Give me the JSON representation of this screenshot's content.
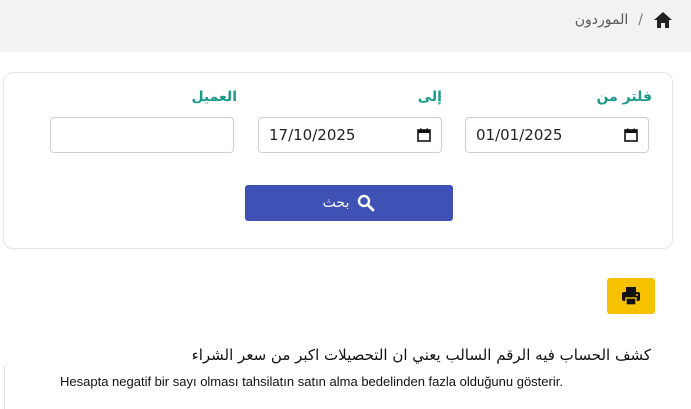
{
  "breadcrumb": {
    "home_icon": "home-icon",
    "separator": "/",
    "current": "الموردون"
  },
  "filters": {
    "from_label": "فلتر من",
    "from_value": "01/01/2025",
    "to_label": "إلى",
    "to_value": "17/10/2025",
    "customer_label": "العميل",
    "customer_value": "",
    "search_label": "بحث"
  },
  "print": {
    "icon": "print-icon"
  },
  "notes": {
    "arabic": "كشف الحساب فيه الرقم السالب يعني ان التحصيلات اكبر من سعر الشراء",
    "turkish": "Hesapta negatif bir sayı olması tahsilatın satın alma bedelinden fazla olduğunu gösterir."
  },
  "colors": {
    "accent": "#3f51b5",
    "label": "#1a9a8a",
    "print": "#f6c200"
  }
}
